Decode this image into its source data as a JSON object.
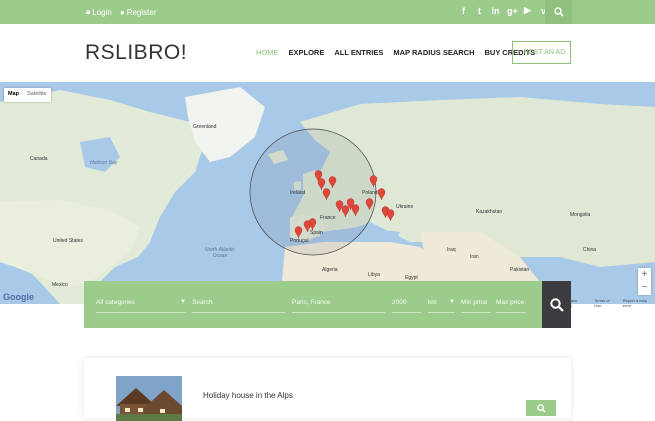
{
  "topbar": {
    "login": "Login",
    "register": "Register",
    "social": [
      "f",
      "t",
      "in",
      "g+",
      "yt",
      "v"
    ]
  },
  "header": {
    "logo": "RSLIBRO!",
    "nav": [
      "HOME",
      "EXPLORE",
      "ALL ENTRIES",
      "MAP RADIUS SEARCH",
      "BUY CREDITS"
    ],
    "post_ad": "+ POST AN AD"
  },
  "map": {
    "type_map": "Map",
    "type_satellite": "Satellite",
    "labels": {
      "greenland": "Greenland",
      "hudson": "Hudson Bay",
      "canada": "Canada",
      "us": "United States",
      "mexico": "Mexico",
      "north_atlantic": "North Atlantic Ocean",
      "kazakhstan": "Kazakhstan",
      "mongolia": "Mongolia",
      "china": "China",
      "iran": "Iran",
      "pakistan": "Pakistan",
      "egypt": "Egypt",
      "algeria": "Algeria",
      "libya": "Libya",
      "iraq": "Iraq",
      "portugal": "Portugal",
      "spain": "Spain",
      "france": "France",
      "poland": "Poland",
      "ukraine": "Ukraine",
      "ireland": "Ireland"
    },
    "google": "Google",
    "attribution": [
      "Map data ©2016",
      "Terms of Use",
      "Report a map error"
    ],
    "zoom_in": "+",
    "zoom_out": "−"
  },
  "search": {
    "category": "All categories",
    "search_placeholder": "Search",
    "location": "Paris, France",
    "radius": "2000",
    "unit": "km",
    "min_price": "Min price",
    "max_price": "Max price"
  },
  "listing": {
    "title": "Holiday house in the Alps"
  }
}
